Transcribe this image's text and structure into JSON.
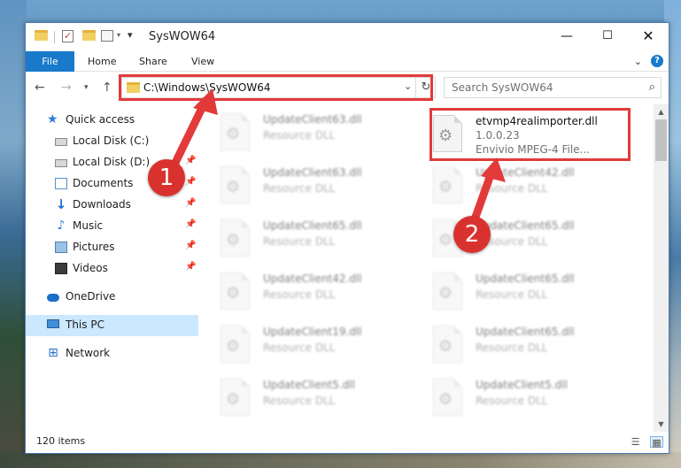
{
  "window": {
    "title": "SysWOW64"
  },
  "ribbon": {
    "tabs": [
      "File",
      "Home",
      "Share",
      "View"
    ]
  },
  "address": {
    "path": "C:\\Windows\\SysWOW64"
  },
  "search": {
    "placeholder": "Search SysWOW64"
  },
  "sidebar": {
    "items": [
      {
        "label": "Quick access"
      },
      {
        "label": "Local Disk (C:)"
      },
      {
        "label": "Local Disk (D:)"
      },
      {
        "label": "Documents"
      },
      {
        "label": "Downloads"
      },
      {
        "label": "Music"
      },
      {
        "label": "Pictures"
      },
      {
        "label": "Videos"
      },
      {
        "label": "OneDrive"
      },
      {
        "label": "This PC"
      },
      {
        "label": "Network"
      }
    ]
  },
  "files": {
    "left": [
      {
        "name": "UpdateClient63.dll",
        "type": "Resource DLL"
      },
      {
        "name": "UpdateClient63.dll",
        "type": "Resource DLL"
      },
      {
        "name": "UpdateClient65.dll",
        "type": "Resource DLL"
      },
      {
        "name": "UpdateClient42.dll",
        "type": "Resource DLL"
      },
      {
        "name": "UpdateClient19.dll",
        "type": "Resource DLL"
      },
      {
        "name": "UpdateClient5.dll",
        "type": "Resource DLL"
      }
    ],
    "highlighted": {
      "name": "etvmp4realimporter.dll",
      "version": "1.0.0.23",
      "description": "Envivio MPEG-4 File..."
    },
    "right": [
      {
        "name": "UpdateClient42.dll",
        "type": "Resource DLL"
      },
      {
        "name": "UpdateClient65.dll",
        "type": "Resource DLL"
      },
      {
        "name": "UpdateClient65.dll",
        "type": "Resource DLL"
      },
      {
        "name": "UpdateClient65.dll",
        "type": "Resource DLL"
      },
      {
        "name": "UpdateClient5.dll",
        "type": "Resource DLL"
      }
    ]
  },
  "status": {
    "item_count": "120 items"
  },
  "annotations": {
    "step1": "1",
    "step2": "2"
  },
  "colors": {
    "accent": "#1979ca",
    "highlight": "#e23a3a",
    "selected": "#cce8ff"
  }
}
